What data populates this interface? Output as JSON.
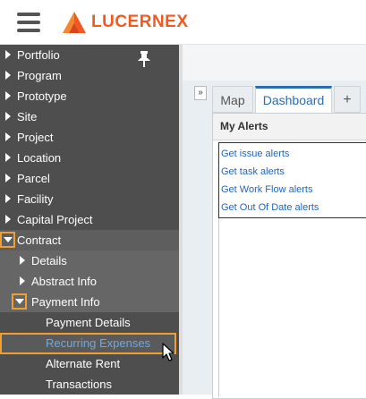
{
  "brand": {
    "name": "LUCERNEX",
    "accent_color": "#f05a22",
    "icon": "lucernex-logo-icon"
  },
  "topbar": {
    "menu_icon": "hamburger-menu-icon"
  },
  "sidebar": {
    "pin_icon": "pin-icon",
    "items": [
      {
        "label": "Portfolio",
        "state": "collapsed"
      },
      {
        "label": "Program",
        "state": "collapsed"
      },
      {
        "label": "Prototype",
        "state": "collapsed"
      },
      {
        "label": "Site",
        "state": "collapsed"
      },
      {
        "label": "Project",
        "state": "collapsed"
      },
      {
        "label": "Location",
        "state": "collapsed"
      },
      {
        "label": "Parcel",
        "state": "collapsed"
      },
      {
        "label": "Facility",
        "state": "collapsed"
      },
      {
        "label": "Capital Project",
        "state": "collapsed"
      },
      {
        "label": "Contract",
        "state": "expanded"
      }
    ],
    "contract_children": [
      {
        "label": "Details",
        "state": "collapsed"
      },
      {
        "label": "Abstract Info",
        "state": "collapsed"
      },
      {
        "label": "Payment Info",
        "state": "expanded"
      }
    ],
    "payment_children": [
      {
        "label": "Payment Details"
      },
      {
        "label": "Recurring Expenses",
        "active": true
      },
      {
        "label": "Alternate Rent"
      },
      {
        "label": "Transactions"
      }
    ],
    "highlight_color": "#f0a030",
    "active_link_color": "#6fa8dc"
  },
  "main": {
    "collapse_button_label": "»",
    "tabs": [
      {
        "label": "Map",
        "selected": false
      },
      {
        "label": "Dashboard",
        "selected": true
      },
      {
        "label": "+",
        "selected": false
      }
    ],
    "panel": {
      "title": "My Alerts",
      "links": [
        "Get issue alerts",
        "Get task alerts",
        "Get Work Flow alerts",
        "Get Out Of Date alerts"
      ]
    }
  }
}
